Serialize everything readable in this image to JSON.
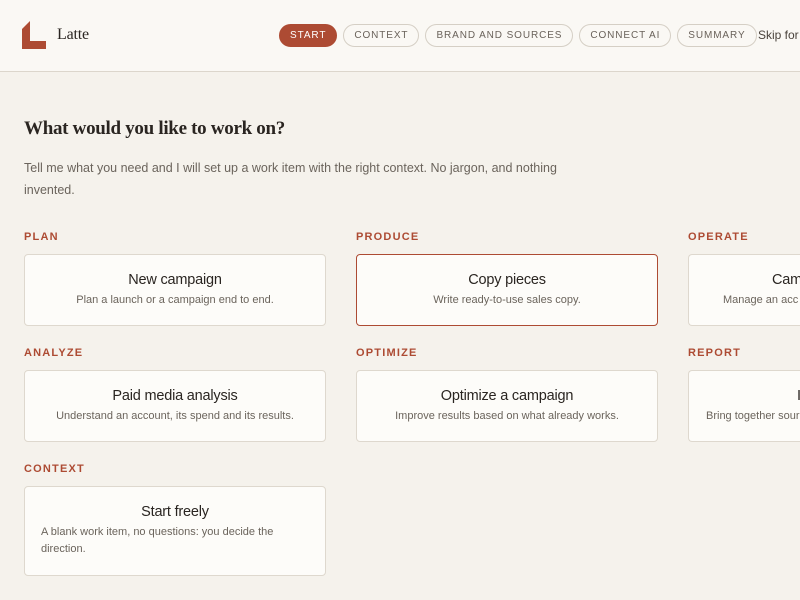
{
  "app": {
    "name": "Latte"
  },
  "header": {
    "steps": [
      {
        "label": "START",
        "active": true
      },
      {
        "label": "CONTEXT",
        "active": false
      },
      {
        "label": "BRAND AND SOURCES",
        "active": false
      },
      {
        "label": "CONNECT AI",
        "active": false
      },
      {
        "label": "SUMMARY",
        "active": false
      }
    ],
    "skip_label": "Skip for"
  },
  "main": {
    "title": "What would you like to work on?",
    "subtitle": "Tell me what you need and I will set up a work item with the right context. No jargon, and nothing invented.",
    "categories": [
      {
        "label": "PLAN",
        "card": {
          "title": "New campaign",
          "description": "Plan a launch or a campaign end to end.",
          "selected": false
        }
      },
      {
        "label": "PRODUCE",
        "card": {
          "title": "Copy pieces",
          "description": "Write ready-to-use sales copy.",
          "selected": true
        }
      },
      {
        "label": "OPERATE",
        "card": {
          "title": "Cam",
          "description": "Manage an acc",
          "selected": false
        }
      },
      {
        "label": "ANALYZE",
        "card": {
          "title": "Paid media analysis",
          "description": "Understand an account, its spend and its results.",
          "selected": false
        }
      },
      {
        "label": "OPTIMIZE",
        "card": {
          "title": "Optimize a campaign",
          "description": "Improve results based on what already works.",
          "selected": false
        }
      },
      {
        "label": "REPORT",
        "card": {
          "title": "I",
          "description": "Bring together sour",
          "selected": false
        }
      },
      {
        "label": "CONTEXT",
        "card": {
          "title": "Start freely",
          "description": "A blank work item, no questions: you decide the direction.",
          "selected": false
        }
      }
    ]
  },
  "colors": {
    "accent": "#ad4b33",
    "background": "#f5f2ec",
    "card": "#fdfcf9"
  },
  "icons": {
    "logo": "latte-logo-icon"
  }
}
